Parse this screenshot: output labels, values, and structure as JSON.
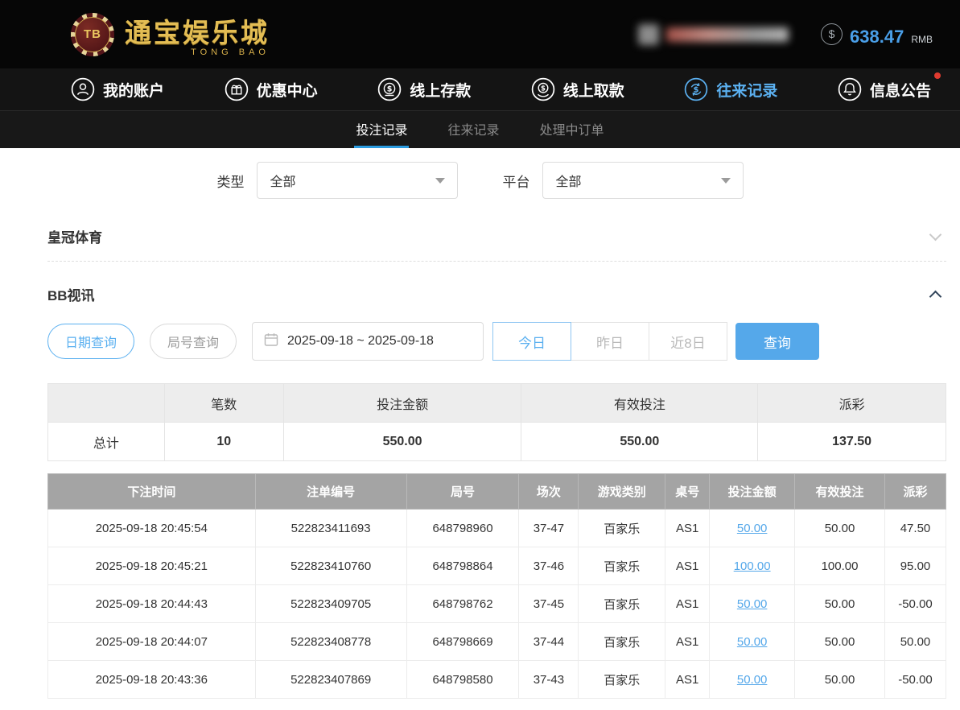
{
  "brand": {
    "chip_text": "TB",
    "title": "通宝娱乐城",
    "subtitle": "TONG BAO"
  },
  "account": {
    "dollar_symbol": "$",
    "balance": "638.47",
    "currency": "RMB"
  },
  "nav": {
    "items": [
      {
        "label": "我的账户",
        "icon": "user-icon",
        "active": false
      },
      {
        "label": "优惠中心",
        "icon": "gift-icon",
        "active": false
      },
      {
        "label": "线上存款",
        "icon": "deposit-icon",
        "active": false
      },
      {
        "label": "线上取款",
        "icon": "withdraw-icon",
        "active": false
      },
      {
        "label": "往来记录",
        "icon": "transfer-records-icon",
        "active": true
      },
      {
        "label": "信息公告",
        "icon": "bell-icon",
        "active": false,
        "has_badge": true
      }
    ]
  },
  "tabs": {
    "items": [
      {
        "label": "投注记录",
        "active": true
      },
      {
        "label": "往来记录",
        "active": false
      },
      {
        "label": "处理中订单",
        "active": false
      }
    ]
  },
  "filters": {
    "type_label": "类型",
    "type_value": "全部",
    "platform_label": "平台",
    "platform_value": "全部"
  },
  "sections": {
    "crown_sports_title": "皇冠体育",
    "bb_video_title": "BB视讯"
  },
  "query_bar": {
    "date_query_label": "日期查询",
    "round_query_label": "局号查询",
    "date_range_value": "2025-09-18 ~ 2025-09-18",
    "today_label": "今日",
    "yesterday_label": "昨日",
    "last8_label": "近8日",
    "search_label": "查询"
  },
  "summary": {
    "headers": [
      "笔数",
      "投注金额",
      "有效投注",
      "派彩"
    ],
    "total_label": "总计",
    "total_values": [
      "10",
      "550.00",
      "550.00",
      "137.50"
    ]
  },
  "table": {
    "headers": [
      "下注时间",
      "注单编号",
      "局号",
      "场次",
      "游戏类别",
      "桌号",
      "投注金额",
      "有效投注",
      "派彩"
    ],
    "rows": [
      [
        "2025-09-18 20:45:54",
        "522823411693",
        "648798960",
        "37-47",
        "百家乐",
        "AS1",
        "50.00",
        "50.00",
        "47.50"
      ],
      [
        "2025-09-18 20:45:21",
        "522823410760",
        "648798864",
        "37-46",
        "百家乐",
        "AS1",
        "100.00",
        "100.00",
        "95.00"
      ],
      [
        "2025-09-18 20:44:43",
        "522823409705",
        "648798762",
        "37-45",
        "百家乐",
        "AS1",
        "50.00",
        "50.00",
        "-50.00"
      ],
      [
        "2025-09-18 20:44:07",
        "522823408778",
        "648798669",
        "37-44",
        "百家乐",
        "AS1",
        "50.00",
        "50.00",
        "50.00"
      ],
      [
        "2025-09-18 20:43:36",
        "522823407869",
        "648798580",
        "37-43",
        "百家乐",
        "AS1",
        "50.00",
        "50.00",
        "-50.00"
      ]
    ]
  },
  "colors": {
    "accent_blue": "#55a8ea",
    "negative_red": "#e8472f",
    "gold": "#e3bd54"
  }
}
